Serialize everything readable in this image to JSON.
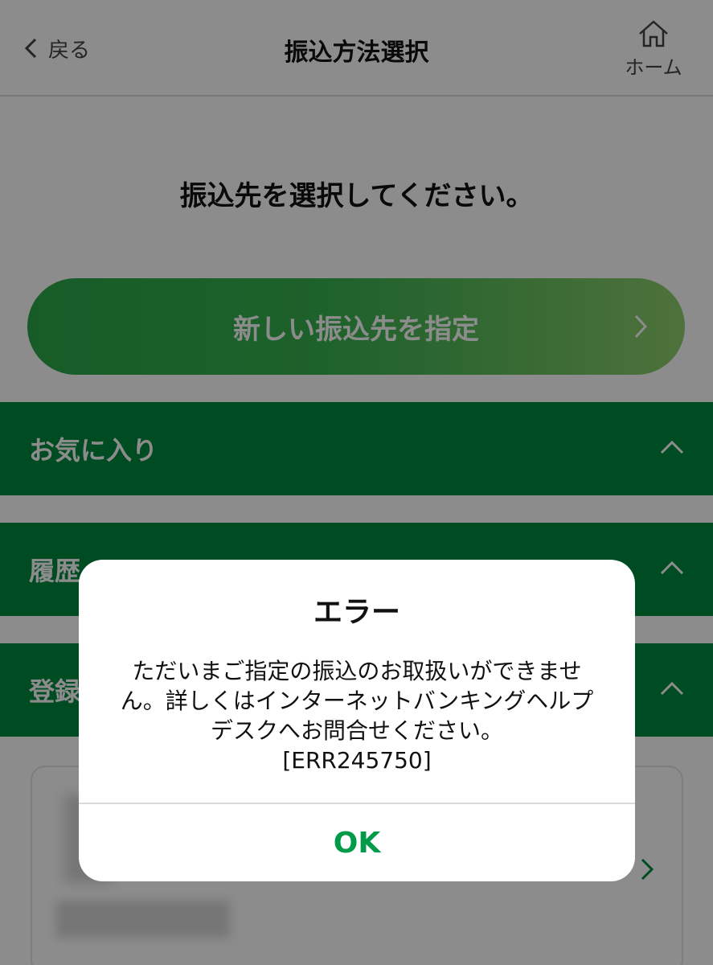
{
  "header": {
    "back_label": "戻る",
    "title": "振込方法選択",
    "home_label": "ホーム"
  },
  "main": {
    "instruction": "振込先を選択してください。",
    "new_payee_button": "新しい振込先を指定",
    "sections": [
      {
        "label": "お気に入り"
      },
      {
        "label": "履歴"
      },
      {
        "label": "登録"
      }
    ]
  },
  "dialog": {
    "title": "エラー",
    "message_lines": [
      "ただいまご指定の振込のお取扱いができませ",
      "ん。詳しくはインターネットバンキングヘルプ",
      "デスクへお問合せください。",
      "[ERR245750]"
    ],
    "ok_label": "OK"
  },
  "colors": {
    "section_green": "#008a3e",
    "ok_green": "#009a48"
  }
}
